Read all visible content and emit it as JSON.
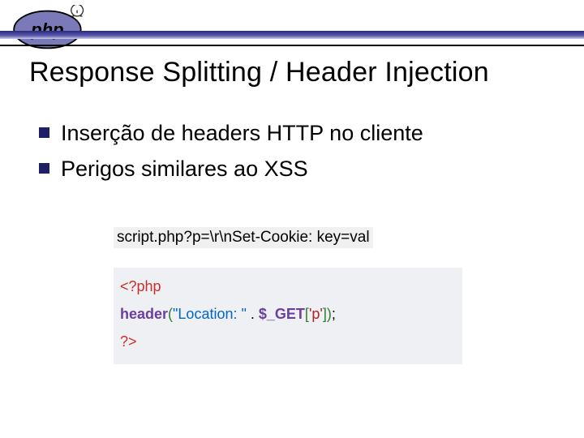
{
  "logo": {
    "alt": "php"
  },
  "title": "Response Splitting / Header Injection",
  "bullets": [
    "Inserção de headers HTTP no cliente",
    "Perigos similares ao XSS"
  ],
  "code": {
    "url": "script.php?p=\\r\\nSet-Cookie: key=val",
    "open_tag": "<?php",
    "header_fn": "header",
    "paren_open": "(",
    "str_literal": "\"Location: \"",
    "dot": " . ",
    "get_var": "$_GET",
    "brack_open": "[",
    "key_literal": "'p'",
    "brack_close": "]",
    "paren_close": ")",
    "semi": ";",
    "close_tag": "?>"
  }
}
